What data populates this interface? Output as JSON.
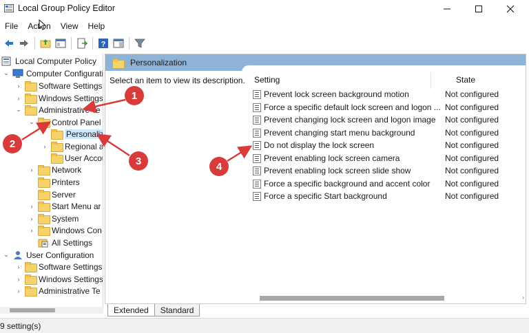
{
  "window": {
    "title": "Local Group Policy Editor"
  },
  "menu": [
    "File",
    "Action",
    "View",
    "Help"
  ],
  "tree": {
    "items": [
      {
        "label": "Local Computer Policy",
        "exp": "",
        "icon": "computer-policy-icon"
      },
      {
        "label": "Computer Configurati",
        "exp": "⌄",
        "icon": "computer-icon"
      },
      {
        "label": "Software Settings",
        "exp": "›",
        "icon": "folder-icon"
      },
      {
        "label": "Windows Settings",
        "exp": "›",
        "icon": "folder-icon"
      },
      {
        "label": "Administrative Te",
        "exp": "⌄",
        "icon": "folder-icon"
      },
      {
        "label": "Control Panel",
        "exp": "⌄",
        "icon": "folder-open-icon"
      },
      {
        "label": "Personaliz",
        "exp": "",
        "icon": "folder-icon"
      },
      {
        "label": "Regional a",
        "exp": "›",
        "icon": "folder-icon"
      },
      {
        "label": "User Accou",
        "exp": "",
        "icon": "folder-icon"
      },
      {
        "label": "Network",
        "exp": "›",
        "icon": "folder-icon"
      },
      {
        "label": "Printers",
        "exp": "",
        "icon": "folder-icon"
      },
      {
        "label": "Server",
        "exp": "",
        "icon": "folder-icon"
      },
      {
        "label": "Start Menu ar",
        "exp": "›",
        "icon": "folder-icon"
      },
      {
        "label": "System",
        "exp": "›",
        "icon": "folder-icon"
      },
      {
        "label": "Windows Con",
        "exp": "›",
        "icon": "folder-icon"
      },
      {
        "label": "All Settings",
        "exp": "",
        "icon": "all-settings-icon"
      },
      {
        "label": "User Configuration",
        "exp": "⌄",
        "icon": "user-icon"
      },
      {
        "label": "Software Settings",
        "exp": "›",
        "icon": "folder-icon"
      },
      {
        "label": "Windows Settings",
        "exp": "›",
        "icon": "folder-icon"
      },
      {
        "label": "Administrative Te",
        "exp": "›",
        "icon": "folder-icon"
      }
    ]
  },
  "right": {
    "header": "Personalization",
    "description": "Select an item to view its description.",
    "col_setting": "Setting",
    "col_state": "State",
    "settings": [
      {
        "name": "Prevent lock screen background motion",
        "state": "Not configured"
      },
      {
        "name": "Force a specific default lock screen and logon ...",
        "state": "Not configured"
      },
      {
        "name": "Prevent changing lock screen and logon image",
        "state": "Not configured"
      },
      {
        "name": "Prevent changing start menu background",
        "state": "Not configured"
      },
      {
        "name": "Do not display the lock screen",
        "state": "Not configured"
      },
      {
        "name": "Prevent enabling lock screen camera",
        "state": "Not configured"
      },
      {
        "name": "Prevent enabling lock screen slide show",
        "state": "Not configured"
      },
      {
        "name": "Force a specific background and accent color",
        "state": "Not configured"
      },
      {
        "name": "Force a specific Start background",
        "state": "Not configured"
      }
    ]
  },
  "tabs": [
    "Extended",
    "Standard"
  ],
  "status": "9 setting(s)",
  "annotations": [
    "1",
    "2",
    "3",
    "4"
  ],
  "colors": {
    "header_blue": "#8fb3d6",
    "callout_red": "#d93a3a",
    "selection": "#cde8ff"
  }
}
